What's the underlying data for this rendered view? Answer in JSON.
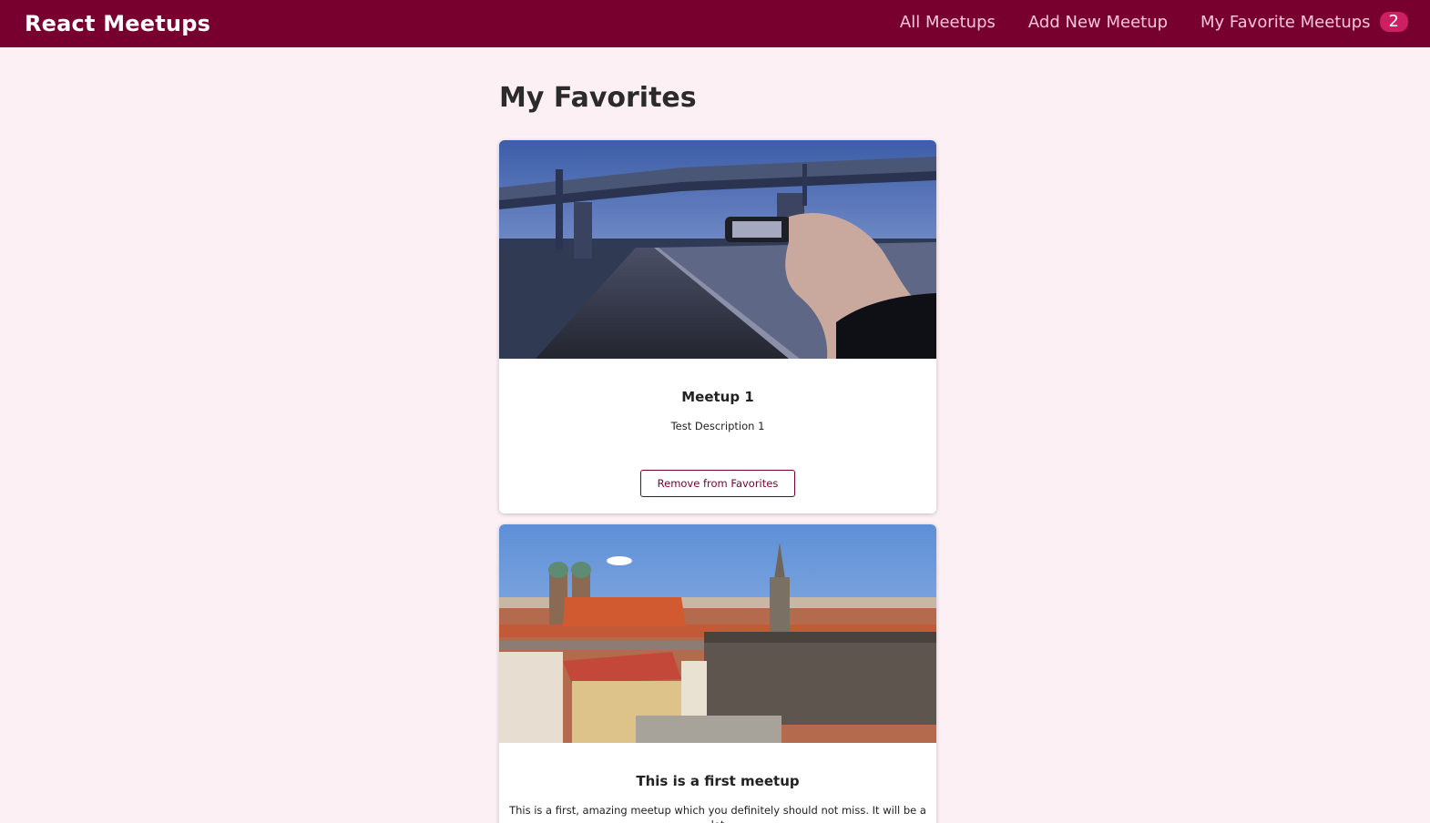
{
  "header": {
    "logo": "React Meetups",
    "nav": {
      "all_meetups": "All Meetups",
      "add_new": "Add New Meetup",
      "favorites": "My Favorite Meetups",
      "favorites_count": "2"
    }
  },
  "page": {
    "title": "My Favorites"
  },
  "meetups": [
    {
      "title": "Meetup 1",
      "description": "Test Description 1",
      "button_label": "Remove from Favorites",
      "image": "photo of a hand holding a phone above an empty road under a bridge at dusk"
    },
    {
      "title": "This is a first meetup",
      "description": "This is a first, amazing meetup which you definitely should not miss. It will be a lot",
      "image": "aerial view of a city with a cathedral and gothic town hall"
    }
  ],
  "colors": {
    "header_bg": "#77002e",
    "page_bg": "#fcf0f5",
    "link": "#fcc5dc",
    "badge_bg": "#cc2062"
  }
}
